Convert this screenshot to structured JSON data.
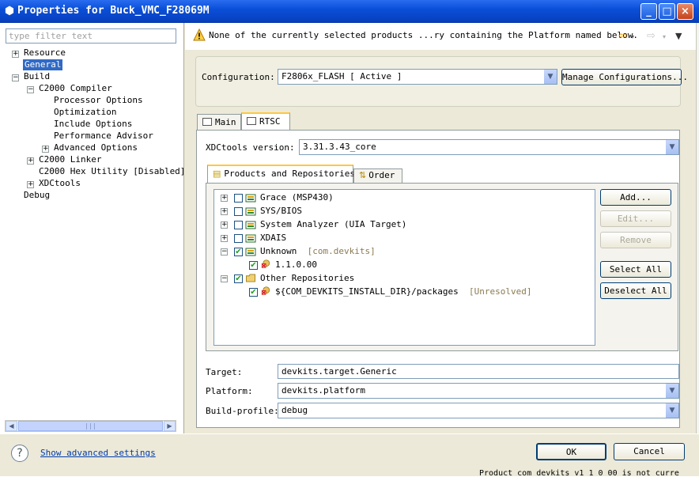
{
  "window": {
    "title": "Properties for Buck_VMC_F28069M",
    "controls": [
      "_",
      "□",
      "×"
    ]
  },
  "left": {
    "filter_placeholder": "type filter text",
    "tree": [
      {
        "label": "Resource"
      },
      {
        "label": "General"
      },
      {
        "label": "Build"
      },
      {
        "label": "C2000 Compiler"
      },
      {
        "label": "Processor Options"
      },
      {
        "label": "Optimization"
      },
      {
        "label": "Include Options"
      },
      {
        "label": "Performance Advisor"
      },
      {
        "label": "Advanced Options"
      },
      {
        "label": "C2000 Linker"
      },
      {
        "label": "C2000 Hex Utility  [Disabled]"
      },
      {
        "label": "XDCtools"
      },
      {
        "label": "Debug"
      }
    ]
  },
  "message": {
    "text": "None of the currently selected products ...ry containing the Platform named below."
  },
  "config": {
    "label": "Configuration:",
    "value": "F2806x_FLASH  [ Active ]",
    "manage_button": "Manage Configurations..."
  },
  "tabs": {
    "main": "Main",
    "rtsc": "RTSC"
  },
  "rtsc": {
    "xdc_label": "XDCtools version:",
    "xdc_value": "3.31.3.43_core",
    "subtabs": {
      "products": "Products and Repositories",
      "order": "Order"
    },
    "items": [
      {
        "label": "Grace (MSP430)",
        "suffix": ""
      },
      {
        "label": "SYS/BIOS",
        "suffix": ""
      },
      {
        "label": "System Analyzer (UIA Target)",
        "suffix": ""
      },
      {
        "label": "XDAIS",
        "suffix": ""
      },
      {
        "label": "Unknown",
        "suffix": "[com.devkits]"
      },
      {
        "label": "1.1.0.00",
        "suffix": ""
      },
      {
        "label": "Other Repositories",
        "suffix": ""
      },
      {
        "label": "${COM_DEVKITS_INSTALL_DIR}/packages",
        "suffix": "[Unresolved]"
      }
    ],
    "buttons": {
      "add": "Add...",
      "edit": "Edit...",
      "remove": "Remove",
      "select_all": "Select All",
      "deselect_all": "Deselect All"
    },
    "target_label": "Target:",
    "target_value": "devkits.target.Generic",
    "platform_label": "Platform:",
    "platform_value": "devkits.platform",
    "profile_label": "Build-profile:",
    "profile_value": "debug"
  },
  "footer": {
    "help": "?",
    "show_advanced": "Show advanced settings",
    "ok": "OK",
    "cancel": "Cancel",
    "background_text": "Product  com devkits  v1 1 0 00 is not curre"
  }
}
